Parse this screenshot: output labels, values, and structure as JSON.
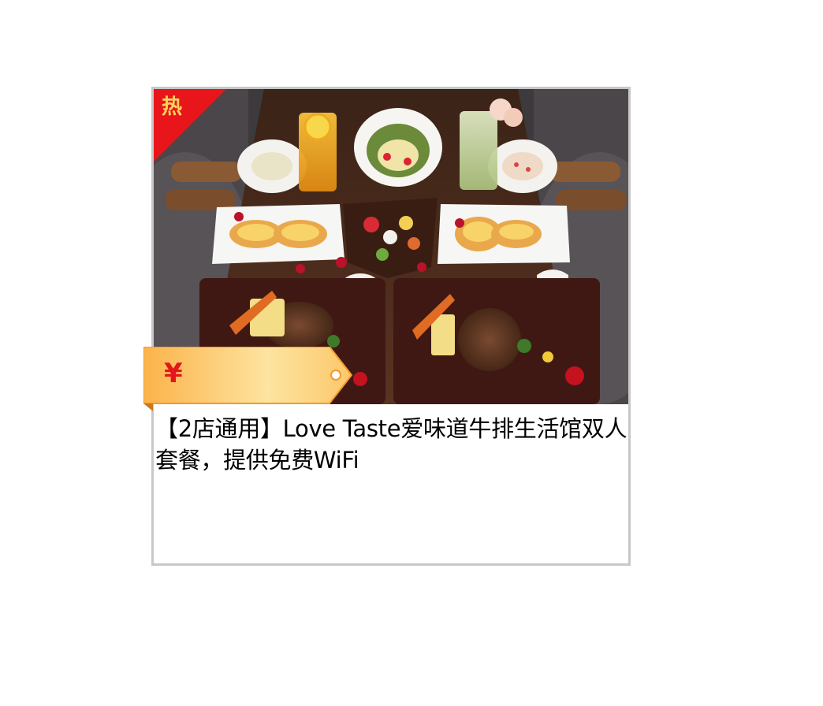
{
  "product": {
    "hot_badge": "热",
    "price_symbol": "¥",
    "price_value": "",
    "title": "【2店通用】Love Taste爱味道牛排生活馆双人套餐，提供免费WiFi",
    "image_alt": "牛排双人套餐"
  },
  "icons": {
    "badge": "hot-corner-ribbon",
    "tag": "price-tag-icon"
  },
  "colors": {
    "badge_red": "#e8161b",
    "badge_text": "#ffd35c",
    "tag_orange": "#fbb34a",
    "tag_light": "#fde7a8",
    "price_red": "#e3171b",
    "border": "#c8c8c8"
  }
}
